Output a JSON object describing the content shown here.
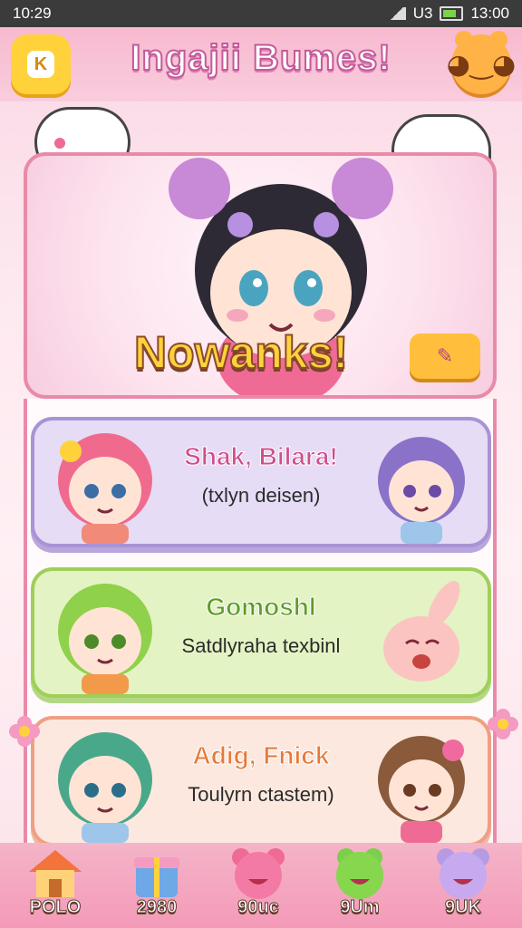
{
  "status_bar": {
    "time_left": "10:29",
    "signal_label": "U3",
    "time_right": "13:00"
  },
  "header": {
    "title": "Ingajii Bumes!",
    "left_button_label": "K"
  },
  "hero": {
    "banner_text": "Nowanks!"
  },
  "cards": [
    {
      "title": "Shak, Bilara!",
      "subtitle": "(txlyn deisen)"
    },
    {
      "title": "Gomoshl",
      "subtitle": "Satdlyraha texbinl"
    },
    {
      "title": "Adig, Fnick",
      "subtitle": "Toulyrn ctastem)"
    }
  ],
  "nav": [
    {
      "label": "POLO",
      "icon": "house-icon"
    },
    {
      "label": "2980",
      "icon": "gift-box-icon"
    },
    {
      "label": "90uc",
      "icon": "pink-bear-icon"
    },
    {
      "label": "9Um",
      "icon": "green-frog-icon"
    },
    {
      "label": "9UK",
      "icon": "purple-bear-icon"
    }
  ],
  "colors": {
    "pink": "#f49ab8",
    "yellow": "#ffd23c",
    "purple": "#a993d4",
    "green": "#9fcf58",
    "peach": "#ef9f84"
  }
}
